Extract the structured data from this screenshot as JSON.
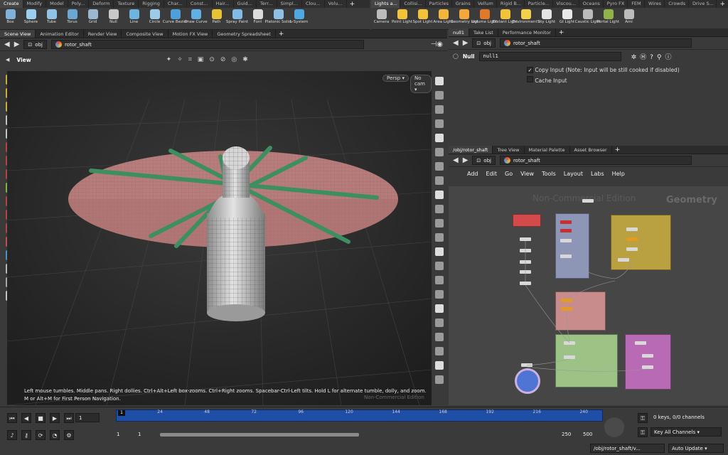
{
  "shelf_left": {
    "tabs": [
      "Create",
      "Modify",
      "Model",
      "Poly...",
      "Deform",
      "Texture",
      "Rigging",
      "Char...",
      "Const...",
      "Hair...",
      "Guid...",
      "Terr...",
      "Simpl...",
      "Clou...",
      "Volu..."
    ],
    "tools": [
      {
        "label": "Box",
        "color": "#7fb1d9"
      },
      {
        "label": "Sphere",
        "color": "#9ad0ee"
      },
      {
        "label": "Tube",
        "color": "#8fc4e6"
      },
      {
        "label": "Torus",
        "color": "#6aa7d3"
      },
      {
        "label": "Grid",
        "color": "#9bb8cf"
      },
      {
        "label": "Null",
        "color": "#c8c8c8"
      },
      {
        "label": "Line",
        "color": "#6fb3e0"
      },
      {
        "label": "Circle",
        "color": "#9ccbea"
      },
      {
        "label": "Curve Bezier",
        "color": "#4fa0da"
      },
      {
        "label": "Draw Curve",
        "color": "#5fb0e4"
      },
      {
        "label": "Path",
        "color": "#e6c236"
      },
      {
        "label": "Spray Paint",
        "color": "#7fbbe6"
      },
      {
        "label": "Font",
        "color": "#dcdcdc"
      },
      {
        "label": "Platonic Solids",
        "color": "#8fbfe6"
      },
      {
        "label": "L-System",
        "color": "#4fa8e0"
      }
    ]
  },
  "shelf_right": {
    "tabs": [
      "Lights a...",
      "Collisi...",
      "Particles",
      "Grains",
      "Vellum",
      "Rigid B...",
      "Particle...",
      "Viscou...",
      "Oceans",
      "Pyro FX",
      "FEM",
      "Wires",
      "Crowds",
      "Drive S..."
    ],
    "tools": [
      {
        "label": "Camera",
        "color": "#bbbbbb"
      },
      {
        "label": "Point Light",
        "color": "#f2c23a"
      },
      {
        "label": "Spot Light",
        "color": "#f2c23a"
      },
      {
        "label": "Area Light",
        "color": "#f2b63a"
      },
      {
        "label": "Geometry Light",
        "color": "#f2a83a"
      },
      {
        "label": "Volume Light",
        "color": "#e07a2a"
      },
      {
        "label": "Distant Light",
        "color": "#f2c23a"
      },
      {
        "label": "Environment Light",
        "color": "#f2d24a"
      },
      {
        "label": "Sky Light",
        "color": "#e4e4e4"
      },
      {
        "label": "GI Light",
        "color": "#e8e8e8"
      },
      {
        "label": "Caustic Light",
        "color": "#bbbbbb"
      },
      {
        "label": "Portal Light",
        "color": "#8fb24a"
      },
      {
        "label": "Ami",
        "color": "#bbbbbb"
      }
    ]
  },
  "left_pane": {
    "tabs": [
      "Scene View",
      "Animation Editor",
      "Render View",
      "Composite View",
      "Motion FX View",
      "Geometry Spreadsheet"
    ],
    "path_root": "obj",
    "path_node": "rotor_shaft",
    "view_label": "View",
    "persp_label": "Persp",
    "cam_label": "No cam",
    "hint": "Left mouse tumbles. Middle pans. Right dollies. Ctrl+Alt+Left box-zooms. Ctrl+Right zooms. Spacebar-Ctrl-Left tilts. Hold L for alternate tumble, dolly, and zoom.",
    "hint2": "M or Alt+M for First Person Navigation.",
    "watermark": "Non-Commercial Edition"
  },
  "param_pane": {
    "tabs": [
      "null1",
      "Take List",
      "Performance Monitor"
    ],
    "path_root": "obj",
    "path_node": "rotor_shaft",
    "node_type": "Null",
    "node_name": "null1",
    "copy_input_label": "Copy Input (Note: Input will be still cooked if disabled)",
    "cache_input_label": "Cache Input"
  },
  "net_pane": {
    "tabs": [
      "/obj/rotor_shaft",
      "Tree View",
      "Material Palette",
      "Asset Browser"
    ],
    "path_root": "obj",
    "path_node": "rotor_shaft",
    "menu": [
      "Add",
      "Edit",
      "Go",
      "View",
      "Tools",
      "Layout",
      "Labs",
      "Help"
    ],
    "watermark": "Non-Commercial Edition",
    "context_label": "Geometry"
  },
  "timeline": {
    "ticks": [
      "1",
      "24",
      "48",
      "72",
      "96",
      "120",
      "144",
      "168",
      "192",
      "216",
      "240"
    ],
    "current_frame": "1",
    "range_start": "1",
    "range_start2": "1",
    "range_end": "250",
    "range_end2": "500",
    "keys_label": "0 keys, 0/0 channels",
    "key_all_label": "Key All Channels",
    "status_path": "/obj/rotor_shaft/v...",
    "auto_update": "Auto Update"
  }
}
